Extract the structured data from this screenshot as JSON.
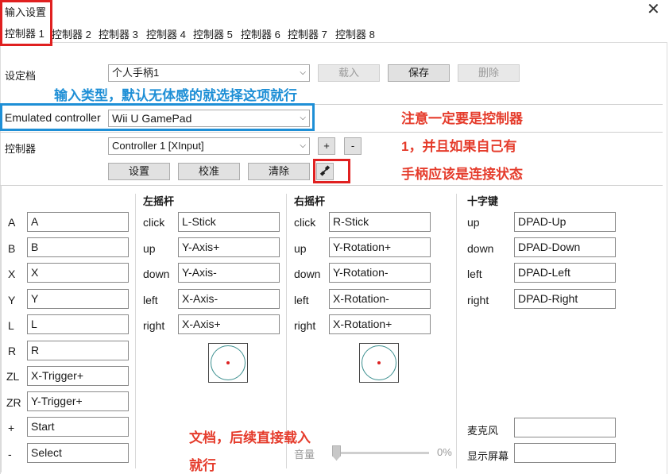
{
  "window": {
    "title": "输入设置",
    "close_glyph": "✕"
  },
  "tabs": [
    {
      "label": "控制器 1"
    },
    {
      "label": "控制器 2"
    },
    {
      "label": "控制器 3"
    },
    {
      "label": "控制器 4"
    },
    {
      "label": "控制器 5"
    },
    {
      "label": "控制器 6"
    },
    {
      "label": "控制器 7"
    },
    {
      "label": "控制器 8"
    }
  ],
  "profile": {
    "label": "设定档",
    "value": "个人手柄1",
    "load_label": "载入",
    "save_label": "保存",
    "delete_label": "删除"
  },
  "emulated": {
    "label": "Emulated controller",
    "value": "Wii U GamePad"
  },
  "controller": {
    "label": "控制器",
    "value": "Controller 1 [XInput]",
    "add_label": "+",
    "remove_label": "-",
    "setup_label": "设置",
    "calibrate_label": "校准",
    "clear_label": "清除",
    "connection_icon": "connected-plug-icon"
  },
  "annotations": {
    "input_type": "输入类型，默认无体感的就选择这项就行",
    "note_line1": "注意一定要是控制器",
    "note_line2": "1，并且如果自己有",
    "note_line3": "手柄应该是连接状态",
    "doc_line1": "文档，后续直接载入",
    "doc_line2": "就行"
  },
  "buttons": [
    {
      "label": "A",
      "value": "A"
    },
    {
      "label": "B",
      "value": "B"
    },
    {
      "label": "X",
      "value": "X"
    },
    {
      "label": "Y",
      "value": "Y"
    },
    {
      "label": "L",
      "value": "L"
    },
    {
      "label": "R",
      "value": "R"
    },
    {
      "label": "ZL",
      "value": "X-Trigger+"
    },
    {
      "label": "ZR",
      "value": "Y-Trigger+"
    },
    {
      "label": "+",
      "value": "Start"
    },
    {
      "label": "-",
      "value": "Select"
    }
  ],
  "left_stick": {
    "title": "左摇杆",
    "rows": [
      {
        "label": "click",
        "value": "L-Stick"
      },
      {
        "label": "up",
        "value": "Y-Axis+"
      },
      {
        "label": "down",
        "value": "Y-Axis-"
      },
      {
        "label": "left",
        "value": "X-Axis-"
      },
      {
        "label": "right",
        "value": "X-Axis+"
      }
    ]
  },
  "right_stick": {
    "title": "右摇杆",
    "rows": [
      {
        "label": "click",
        "value": "R-Stick"
      },
      {
        "label": "up",
        "value": "Y-Rotation+"
      },
      {
        "label": "down",
        "value": "Y-Rotation-"
      },
      {
        "label": "left",
        "value": "X-Rotation-"
      },
      {
        "label": "right",
        "value": "X-Rotation+"
      }
    ]
  },
  "dpad": {
    "title": "十字键",
    "rows": [
      {
        "label": "up",
        "value": "DPAD-Up"
      },
      {
        "label": "down",
        "value": "DPAD-Down"
      },
      {
        "label": "left",
        "value": "DPAD-Left"
      },
      {
        "label": "right",
        "value": "DPAD-Right"
      }
    ]
  },
  "volume": {
    "label": "音量",
    "value_text": "0%",
    "value": 0
  },
  "extra": {
    "mic_label": "麦克风",
    "mic_value": "",
    "screen_label": "显示屏幕",
    "screen_value": ""
  },
  "colors": {
    "annotation_red": "#e53c2c",
    "annotation_blue": "#1e8fd6",
    "highlight_box_red": "#e02020",
    "highlight_box_blue": "#1e8fd6"
  }
}
